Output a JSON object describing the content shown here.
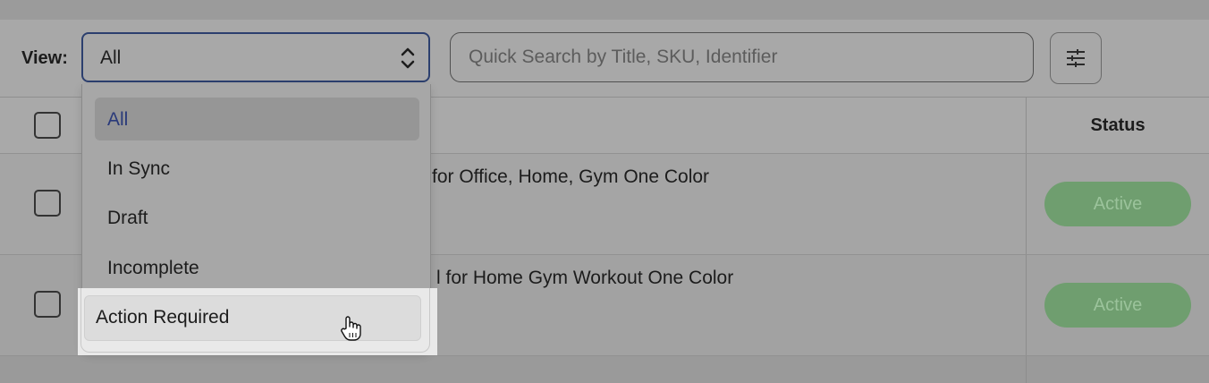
{
  "toolbar": {
    "view_label": "View:",
    "view_value": "All",
    "search_placeholder": "Quick Search by Title, SKU, Identifier"
  },
  "table": {
    "status_header": "Status",
    "rows": [
      {
        "title": "for Office, Home, Gym One Color",
        "status": "Active"
      },
      {
        "title": "l for Home Gym Workout One Color",
        "status": "Active"
      }
    ]
  },
  "dropdown": {
    "options": [
      "All",
      "In Sync",
      "Draft",
      "Incomplete",
      "Action Required"
    ],
    "selected": "All",
    "hovered": "Action Required"
  },
  "colors": {
    "select_border": "#2c3f6e",
    "selected_option_text": "#2a3a7a",
    "active_badge": "#6f9e6f"
  }
}
